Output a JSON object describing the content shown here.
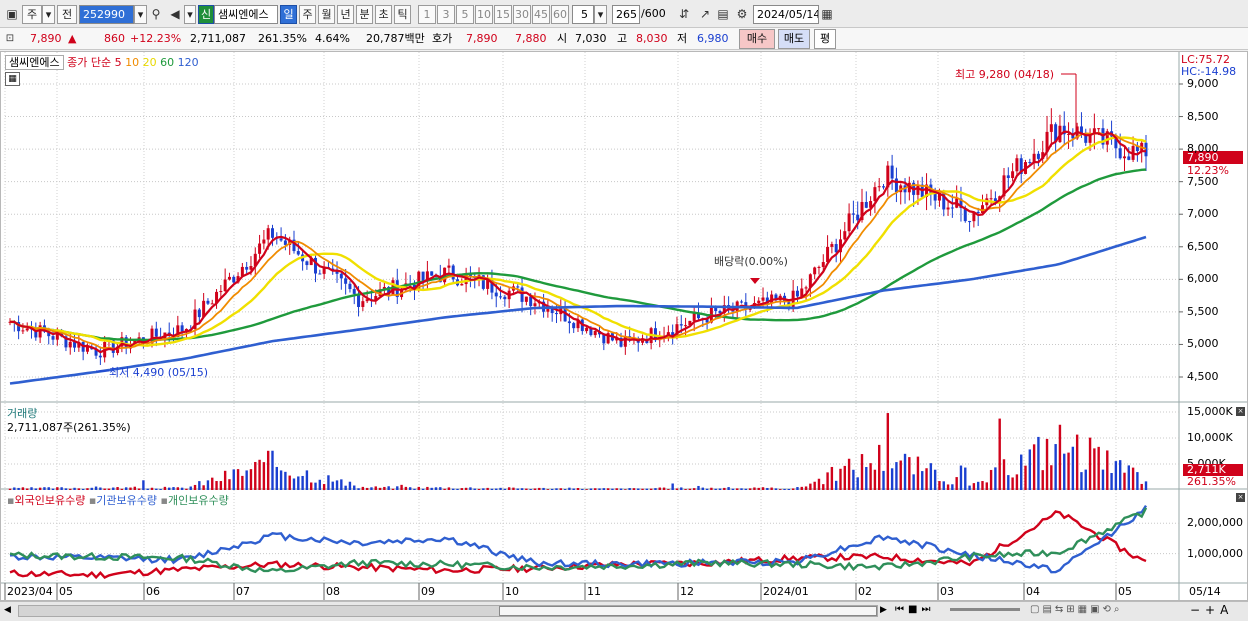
{
  "toolbar": {
    "market": "주",
    "type": "전",
    "code": "252990",
    "name": "샘씨엔에스",
    "new_badge": "신",
    "periods": [
      "일",
      "주",
      "월",
      "년",
      "분",
      "초",
      "틱"
    ],
    "active_period": "일",
    "intervals": [
      "1",
      "3",
      "5",
      "10",
      "15",
      "30",
      "45",
      "60"
    ],
    "interval_value": "5",
    "count": "265",
    "count_max": "/600",
    "date": "2024/05/14"
  },
  "info": {
    "price": "7,890",
    "arrow": "▲",
    "change": "860",
    "change_pct": "+12.23%",
    "volume": "2,711,087",
    "volume_ratio": "261.35%",
    "turnover": "4.64%",
    "amount": "20,787백만",
    "hoga_label": "호가",
    "ask": "7,890",
    "bid": "7,880",
    "open_label": "시",
    "open": "7,030",
    "high_label": "고",
    "high": "8,030",
    "low_label": "저",
    "low": "6,980",
    "buy_btn": "매수",
    "sell_btn": "매도",
    "eval_btn": "평"
  },
  "price_panel": {
    "title": "샘씨엔에스",
    "ma_label": "종가 단순",
    "ma_periods": [
      {
        "p": "5",
        "color": "#d0021b"
      },
      {
        "p": "10",
        "color": "#f08c00"
      },
      {
        "p": "20",
        "color": "#e8d800"
      },
      {
        "p": "60",
        "color": "#1f9a3c"
      },
      {
        "p": "120",
        "color": "#2f5fd0"
      }
    ],
    "lc": "LC:75.72",
    "hc": "HC:-14.98",
    "max_note": "최고 9,280 (04/18)",
    "min_note": "최저 4,490 (05/15)",
    "div_note": "배당락(0.00%)",
    "last_price_tag": "7,890",
    "last_pct_tag": "12.23%",
    "y_ticks": [
      "9,000",
      "8,500",
      "8,000",
      "7,500",
      "7,000",
      "6,500",
      "6,000",
      "5,500",
      "5,000",
      "4,500"
    ]
  },
  "volume_panel": {
    "title": "거래량",
    "value": "2,711,087주(261.35%)",
    "y_ticks": [
      "15,000K",
      "10,000K",
      "5,000K"
    ],
    "last_tag": "2,711K",
    "last_pct": "261.35%"
  },
  "holdings_panel": {
    "items": [
      {
        "label": "외국인보유수량",
        "color": "#d0021b"
      },
      {
        "label": "기관보유수량",
        "color": "#2f5fd0"
      },
      {
        "label": "개인보유수량",
        "color": "#2f8f5a"
      }
    ],
    "y_ticks": [
      "2,000,000",
      "1,000,000"
    ]
  },
  "x_axis": [
    "2023/04",
    "05",
    "06",
    "07",
    "08",
    "09",
    "10",
    "11",
    "12",
    "2024/01",
    "02",
    "03",
    "04",
    "05",
    "05/14"
  ],
  "chart_data": [
    {
      "type": "line",
      "title": "샘씨엔에스",
      "x": [
        "2023/04",
        "05",
        "06",
        "07",
        "08",
        "09",
        "10",
        "11",
        "12",
        "2024/01",
        "02",
        "03",
        "04",
        "05"
      ],
      "series": [
        {
          "name": "5",
          "values": [
            5350,
            4900,
            5250,
            6700,
            5700,
            6100,
            5700,
            5000,
            5450,
            5700,
            7600,
            7000,
            8350,
            7890
          ]
        },
        {
          "name": "120",
          "values": [
            4400,
            4580,
            4780,
            5050,
            5230,
            5420,
            5560,
            5590,
            5580,
            5560,
            5830,
            6000,
            6230,
            6650
          ]
        }
      ],
      "ylim": [
        4300,
        9300
      ]
    },
    {
      "type": "bar",
      "title": "거래량",
      "x": [
        "2023/04",
        "05",
        "06",
        "07",
        "08",
        "09",
        "10",
        "11",
        "12",
        "2024/01",
        "02",
        "03",
        "04",
        "05"
      ],
      "values": [
        500,
        700,
        600,
        8000,
        800,
        700,
        500,
        400,
        600,
        500,
        10500,
        1000,
        14500,
        2711
      ],
      "ylim": [
        0,
        15000
      ]
    },
    {
      "type": "line",
      "title": "보유수량",
      "x": [
        "2023/04",
        "05",
        "06",
        "07",
        "08",
        "09",
        "10",
        "11",
        "12",
        "2024/01",
        "02",
        "03",
        "04",
        "05"
      ],
      "series": [
        {
          "name": "외국인보유수량",
          "values": [
            350000,
            300000,
            480000,
            650000,
            550000,
            450000,
            520000,
            650000,
            700000,
            850000,
            900000,
            650000,
            2350000,
            700000
          ]
        },
        {
          "name": "기관보유수량",
          "values": [
            900000,
            850000,
            800000,
            1600000,
            1350000,
            1500000,
            700000,
            650000,
            700000,
            750000,
            1550000,
            950000,
            450000,
            2500000
          ]
        },
        {
          "name": "개인보유수량",
          "values": [
            950000,
            900000,
            850000,
            400000,
            700000,
            650000,
            550000,
            600000,
            700000,
            650000,
            550000,
            900000,
            1050000,
            2400000
          ]
        }
      ],
      "ylim": [
        0,
        2800000
      ]
    }
  ]
}
